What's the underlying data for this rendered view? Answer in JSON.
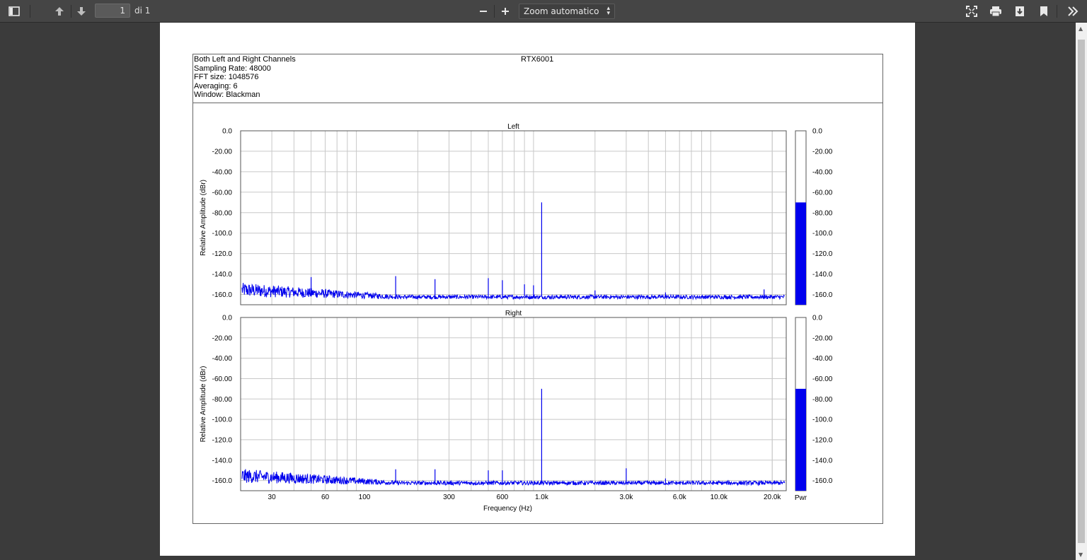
{
  "toolbar": {
    "page_number": "1",
    "page_total": "di 1",
    "zoom_label": "Zoom automatico"
  },
  "document": {
    "header_lines": [
      "Both Left and Right Channels",
      "Sampling Rate: 48000",
      "FFT size: 1048576",
      "Averaging: 6",
      "Window: Blackman"
    ],
    "device": "RTX6001"
  },
  "chart_data": [
    {
      "type": "line",
      "title": "Left",
      "xlabel": "Frequency (Hz)",
      "ylabel": "Relative Amplitude (dBr)",
      "x_scale": "log",
      "xlim": [
        20,
        24000
      ],
      "ylim": [
        -170,
        0
      ],
      "y_ticks": [
        "0.0",
        "-20.00",
        "-40.00",
        "-60.00",
        "-80.00",
        "-100.0",
        "-120.0",
        "-140.0",
        "-160.0"
      ],
      "noise_floor_db": -162,
      "peaks": [
        {
          "x": 1000,
          "y": -70
        },
        {
          "x": 50,
          "y": -143
        },
        {
          "x": 150,
          "y": -142
        },
        {
          "x": 250,
          "y": -145
        },
        {
          "x": 500,
          "y": -144
        },
        {
          "x": 600,
          "y": -146
        },
        {
          "x": 800,
          "y": -150
        },
        {
          "x": 900,
          "y": -151
        },
        {
          "x": 2000,
          "y": -156
        },
        {
          "x": 5000,
          "y": -158
        },
        {
          "x": 18000,
          "y": -155
        }
      ],
      "meter_value_db": -70,
      "meter_label": "Pwr",
      "meter_ticks": [
        "0.0",
        "-20.00",
        "-40.00",
        "-60.00",
        "-80.00",
        "-100.0",
        "-120.0",
        "-140.0",
        "-160.0"
      ]
    },
    {
      "type": "line",
      "title": "Right",
      "xlabel": "Frequency (Hz)",
      "ylabel": "Relative Amplitude (dBr)",
      "x_scale": "log",
      "xlim": [
        20,
        24000
      ],
      "ylim": [
        -170,
        0
      ],
      "y_ticks": [
        "0.0",
        "-20.00",
        "-40.00",
        "-60.00",
        "-80.00",
        "-100.0",
        "-120.0",
        "-140.0",
        "-160.0"
      ],
      "x_ticks": [
        {
          "v": 30,
          "t": "30"
        },
        {
          "v": 60,
          "t": "60"
        },
        {
          "v": 100,
          "t": "100"
        },
        {
          "v": 300,
          "t": "300"
        },
        {
          "v": 600,
          "t": "600"
        },
        {
          "v": 1000,
          "t": "1.0k"
        },
        {
          "v": 3000,
          "t": "3.0k"
        },
        {
          "v": 6000,
          "t": "6.0k"
        },
        {
          "v": 10000,
          "t": "10.0k"
        },
        {
          "v": 20000,
          "t": "20.0k"
        }
      ],
      "noise_floor_db": -162,
      "peaks": [
        {
          "x": 1000,
          "y": -70
        },
        {
          "x": 150,
          "y": -149
        },
        {
          "x": 250,
          "y": -149
        },
        {
          "x": 500,
          "y": -150
        },
        {
          "x": 600,
          "y": -150
        },
        {
          "x": 3000,
          "y": -148
        },
        {
          "x": 5000,
          "y": -158
        }
      ],
      "meter_value_db": -70,
      "meter_label": "Pwr",
      "meter_ticks": [
        "0.0",
        "-20.00",
        "-40.00",
        "-60.00",
        "-80.00",
        "-100.0",
        "-120.0",
        "-140.0",
        "-160.0"
      ]
    }
  ]
}
